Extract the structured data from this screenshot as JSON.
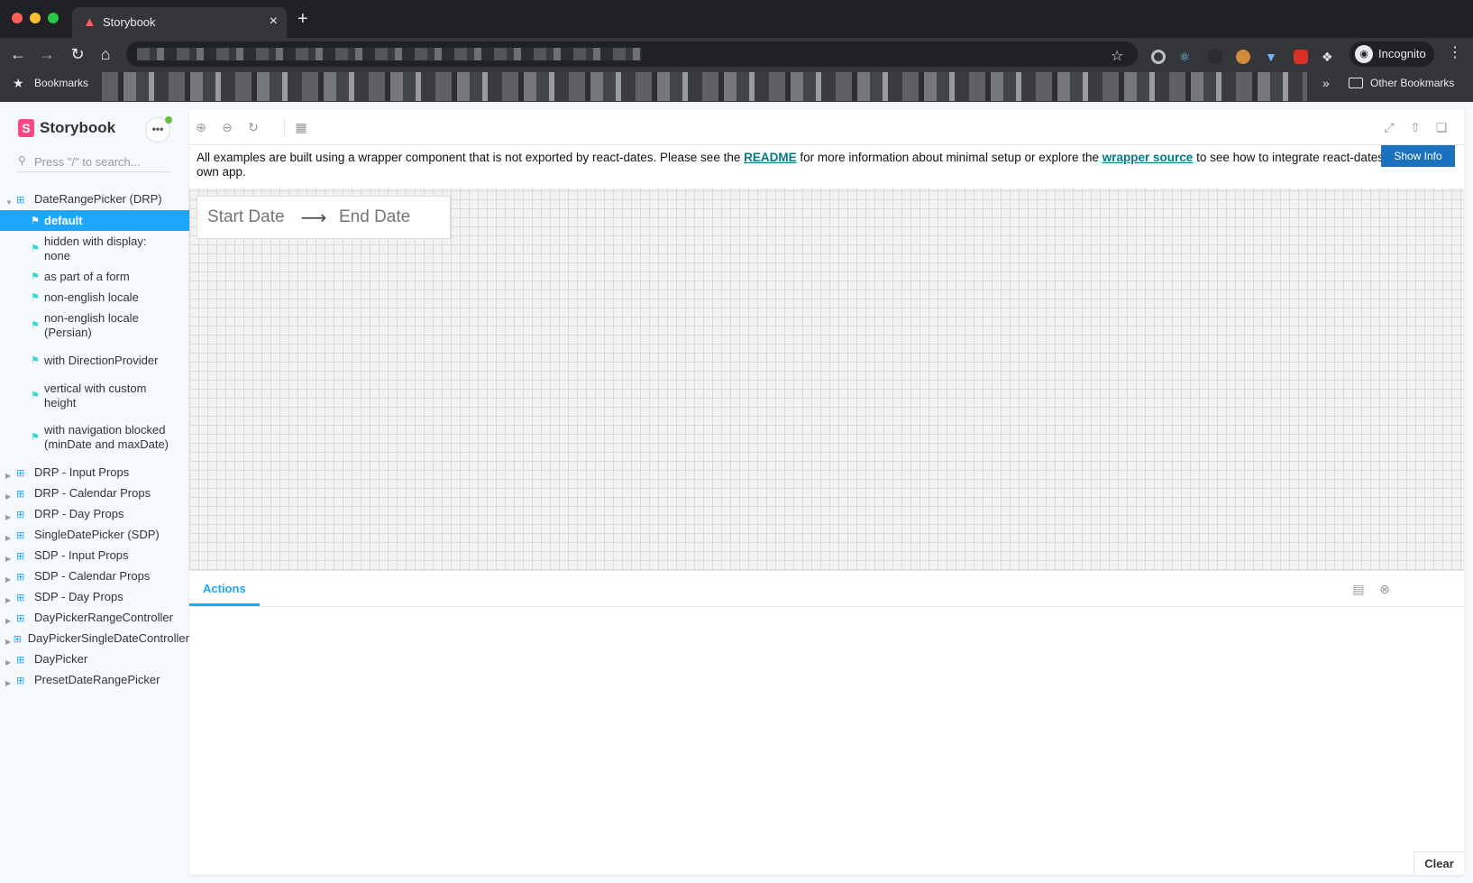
{
  "browser": {
    "tab_title": "Storybook",
    "bookmarks_label": "Bookmarks",
    "other_bookmarks_label": "Other Bookmarks",
    "profile_label": "Incognito"
  },
  "sidebar": {
    "brand": "Storybook",
    "search_placeholder": "Press \"/\" to search...",
    "groups": [
      {
        "label": "DateRangePicker (DRP)",
        "expanded": true,
        "stories": [
          {
            "label": "default",
            "selected": true
          },
          {
            "label": "hidden with display: none"
          },
          {
            "label": "as part of a form"
          },
          {
            "label": "non-english locale"
          },
          {
            "label": "non-english locale (Persian)"
          },
          {
            "label": "with DirectionProvider"
          },
          {
            "label": "vertical with custom height"
          },
          {
            "label": "with navigation blocked (minDate and maxDate)"
          }
        ]
      },
      {
        "label": "DRP - Input Props"
      },
      {
        "label": "DRP - Calendar Props"
      },
      {
        "label": "DRP - Day Props"
      },
      {
        "label": "SingleDatePicker (SDP)"
      },
      {
        "label": "SDP - Input Props"
      },
      {
        "label": "SDP - Calendar Props"
      },
      {
        "label": "SDP - Day Props"
      },
      {
        "label": "DayPickerRangeController"
      },
      {
        "label": "DayPickerSingleDateController"
      },
      {
        "label": "DayPicker"
      },
      {
        "label": "PresetDateRangePicker"
      }
    ]
  },
  "preview": {
    "info_text_1": "All examples are built using a wrapper component that is not exported by react-dates. Please see the ",
    "readme_link": "README",
    "info_text_2": " for more information about minimal setup or explore the ",
    "wrapper_link": "wrapper source",
    "info_text_3": " to see how to integrate react-dates into your own app.",
    "show_info_label": "Show Info",
    "start_date_placeholder": "Start Date",
    "end_date_placeholder": "End Date"
  },
  "addons": {
    "active_tab": "Actions",
    "clear_label": "Clear"
  },
  "colors": {
    "accent": "#1ea7fd",
    "brand": "#ff4785",
    "link": "#007a87"
  }
}
